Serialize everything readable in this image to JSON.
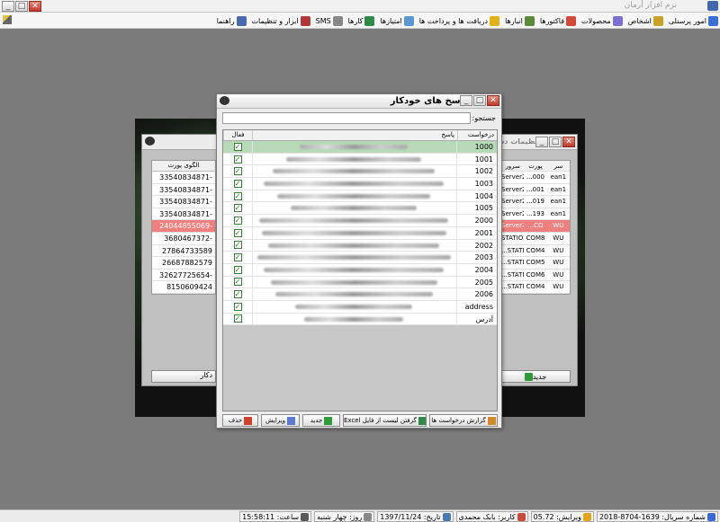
{
  "app": {
    "title": "نرم افزار آرمان"
  },
  "menu": [
    {
      "label": "امور پرسنلی",
      "icon": "personnel-icon",
      "color": "#3b6ed6"
    },
    {
      "label": "اشخاص",
      "icon": "people-icon",
      "color": "#c9a227"
    },
    {
      "label": "محصولات",
      "icon": "products-icon",
      "color": "#7a6fd0"
    },
    {
      "label": "فاکتورها",
      "icon": "invoices-icon",
      "color": "#d04a3a"
    },
    {
      "label": "انبارها",
      "icon": "warehouse-icon",
      "color": "#5a8a3a"
    },
    {
      "label": "دریافت ها و پرداخت ها",
      "icon": "payments-icon",
      "color": "#e2b21a"
    },
    {
      "label": "امتیازها",
      "icon": "points-icon",
      "color": "#5a9ad0"
    },
    {
      "label": "کارها",
      "icon": "tasks-icon",
      "color": "#2f8a4a"
    },
    {
      "label": "SMS",
      "icon": "sms-icon",
      "color": "#888888"
    },
    {
      "label": "ابزار و تنظیمات",
      "icon": "tools-icon",
      "color": "#b03a3a"
    },
    {
      "label": "راهنما",
      "icon": "help-icon",
      "color": "#4a6ab0"
    }
  ],
  "back_window": {
    "title": "تنظیمات دس",
    "left_header": "الگوی پورت",
    "left_rows": [
      "33540834871-",
      "33540834871-",
      "33540834871-",
      "33540834871-",
      "24044855069-",
      "3680467372-",
      "27864733589",
      "26687882579",
      "32627725654-",
      "8150609424"
    ],
    "left_selected": 4,
    "right_headers": [
      "سرور",
      "پورت",
      "سر"
    ],
    "right_rows": [
      [
        "Server2",
        "...000",
        "ean1"
      ],
      [
        "Server2",
        "...001",
        "ean1"
      ],
      [
        "Server2",
        "...019",
        "ean1"
      ],
      [
        "Server2",
        "...193",
        "ean1"
      ],
      [
        "Server2",
        "...CO",
        "WU"
      ],
      [
        "STATION",
        "COM8",
        "WU"
      ],
      [
        "...STATI",
        "COM4",
        "WU"
      ],
      [
        "...STATI",
        "COM5",
        "WU"
      ],
      [
        "...STATI",
        "COM6",
        "WU"
      ],
      [
        "...STATI",
        "COM4",
        "WU"
      ]
    ],
    "right_selected": 4,
    "new_label": "جدید",
    "left_button_label": "دکار"
  },
  "dialog": {
    "title": "پاسخ های خودکار",
    "search_label": "جستجو:",
    "search_value": "",
    "columns": {
      "request": "درخواست",
      "answer": "پاسخ",
      "active": "فعال"
    },
    "rows": [
      {
        "request": "1000",
        "active": true,
        "selected": true
      },
      {
        "request": "1001",
        "active": true
      },
      {
        "request": "1002",
        "active": true
      },
      {
        "request": "1003",
        "active": true
      },
      {
        "request": "1004",
        "active": true
      },
      {
        "request": "1005",
        "active": true
      },
      {
        "request": "2000",
        "active": true
      },
      {
        "request": "2001",
        "active": true
      },
      {
        "request": "2002",
        "active": true
      },
      {
        "request": "2003",
        "active": true
      },
      {
        "request": "2004",
        "active": true
      },
      {
        "request": "2005",
        "active": true
      },
      {
        "request": "2006",
        "active": true
      },
      {
        "request": "address",
        "active": true
      },
      {
        "request": "آدرس",
        "active": true
      }
    ],
    "buttons": {
      "report": "گزارش درخواست ها",
      "excel": "گرفتن لیست از فایل Excel",
      "new": "جدید",
      "edit": "ویرایش",
      "delete": "حذف"
    }
  },
  "status": [
    {
      "label": "شماره سریال: 1639-8704-2018",
      "icon": "serial-icon",
      "color": "#3a6ad0"
    },
    {
      "label": "ویرایش: 05.72",
      "icon": "version-icon",
      "color": "#e2a21a"
    },
    {
      "label": "کاربر: بابک محمدی",
      "icon": "user-icon",
      "color": "#c94a3a"
    },
    {
      "label": "تاریخ: 1397/11/24",
      "icon": "calendar-icon",
      "color": "#4a7ab0"
    },
    {
      "label": "روز: چهار شنبه",
      "icon": "day-icon",
      "color": "#888888"
    },
    {
      "label": "ساعت: 15:58:11",
      "icon": "clock-icon",
      "color": "#5a5a5a"
    }
  ]
}
